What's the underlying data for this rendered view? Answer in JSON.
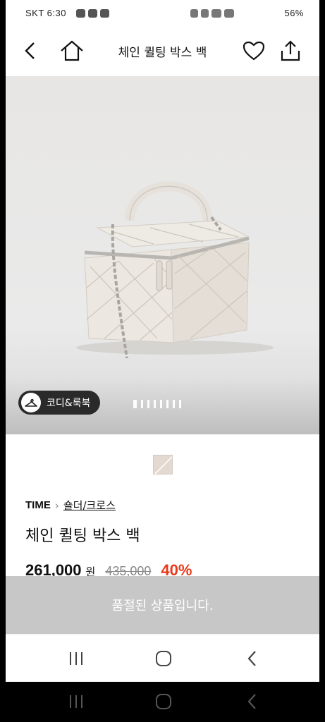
{
  "status_bar": {
    "time": "SKT 6:30",
    "battery": "56%"
  },
  "header": {
    "title": "체인 퀼팅 박스 백"
  },
  "hero": {
    "lookbook_label": "코디&룩북",
    "image_count": 8,
    "current_image": 1
  },
  "product": {
    "brand": "TIME",
    "category": "숄더/크로스",
    "name": "체인 퀼팅 박스 백",
    "price": "261,000",
    "currency": "원",
    "original_price": "435,000",
    "discount": "40%",
    "swatch_color": "#e3d9d0"
  },
  "soldout_banner": "품절된 상품입니다.",
  "colors": {
    "discount": "#e8391b",
    "soldout_bg": "#c7c7c7"
  }
}
